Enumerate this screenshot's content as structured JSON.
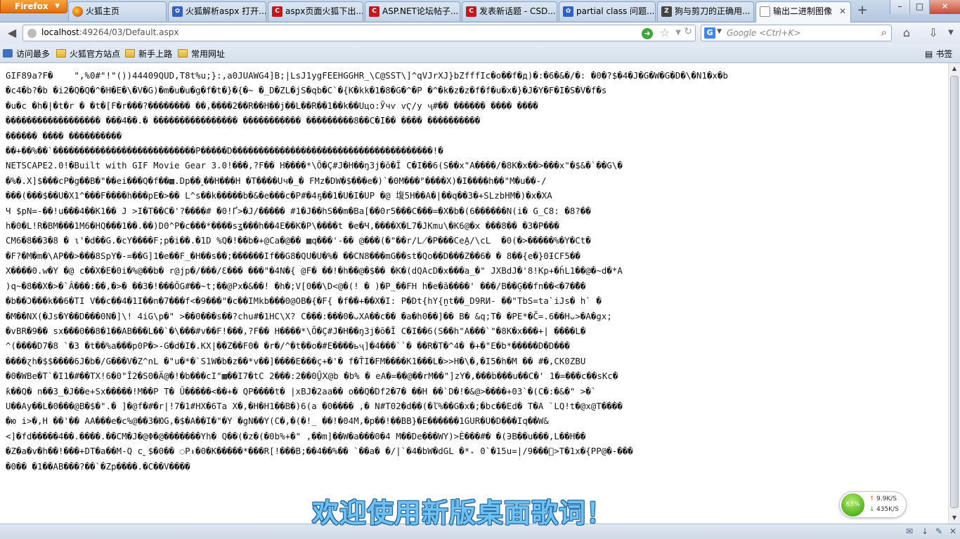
{
  "browser": {
    "menu_button": "Firefox",
    "tabs": [
      {
        "label": "火狐主页",
        "icon": "firefox-icon"
      },
      {
        "label": "火狐解析aspx 打开...",
        "icon": "paw-icon"
      },
      {
        "label": "aspx页面火狐下出...",
        "icon": "csdn-icon"
      },
      {
        "label": "ASP.NET论坛帖子...",
        "icon": "csdn-icon"
      },
      {
        "label": "发表新话题 - CSD...",
        "icon": "csdn-icon"
      },
      {
        "label": "partial class 问题...",
        "icon": "paw-icon"
      },
      {
        "label": "狗与剪刀的正确用...",
        "icon": "zhihu-icon"
      },
      {
        "label": "输出二进制图像",
        "icon": "page-icon",
        "active": true
      }
    ],
    "new_tab": "+",
    "window_controls": {
      "minimize": "–",
      "maximize": "□",
      "close": "✕"
    }
  },
  "navigation": {
    "url_host": "localhost",
    "url_rest": ":49264/03/Default.aspx",
    "search_engine": "G",
    "search_placeholder": "Google <Ctrl+K>"
  },
  "bookmarks": {
    "items": [
      {
        "label": "访问最多",
        "icon": "bookmark-icon"
      },
      {
        "label": "火狐官方站点",
        "icon": "folder-icon"
      },
      {
        "label": "新手上路",
        "icon": "folder-icon"
      },
      {
        "label": "常用网址",
        "icon": "folder-icon"
      }
    ],
    "right_label": "书签"
  },
  "page": {
    "lines": [
      "GIF89a?F�    \",%0#\"!\"())44409QUD,T8t%u;}:,a0JUAWG4]B;|LsJ1ygFEEHGGHR_\\C@SST\\]^qVJrXJ}bZfffIc�o��f�д)�:�6�&�/�: �0�?$�4�J�G�W�G�D�\\�N1�x�b",
      "�c4�b?�b �i2�Q�Q�^�H�E�\\�V�G)�m�u�u�g�f�t�}�{�~ �_D�ZL�jS�qb�C`�{K�kk�1�8�G�^�P �^�k�z�z�f�f�u�x�}�J�Y�F�I�S�V�f�s",
      "�u�c �h�|�t�r � �t�[F�r���?�������� ��,����2��R��H��j��L��R��1��k��Uцo:Ўчѵ ѵҀ/у ҷ#�� ������ ���� ����",
      "������������������ ���4��.� ���������������� ����������� ���������8��C�I�� ���� ����������",
      "������ ���� ����������",
      "��+��%��`���������������������������P�����D��������������������������������������!�",
      "NETSCAPE2.0!�Built with GIF Movie Gear 3.0!���,?F�� H����*\\Õ�Ç#J�H��ŋ3j�ō�Ĭ C�I��6(S��x\"A����/�8K�x��>���x\"�$&�`��G\\�",
      "�%�.X]$���cP�g��B�\"��ei���Q�f��▩.Dp��‸��H���H �T����Uч�_� FMz�DW�$���e�)`�0M���ᴾ����X)�I����h��\"M�u��-/",
      "���(���$��U�X1^���F����h���pE�>�� L^s��k�����b�&�e���c�P#�4ҕ��1�U�I�UP �@ 㙏5H��A�|��q��3�+SLzbHM�)�x�XA",
      "Ч $pN=-��!u���4��K1�� J >I�T��C�'?����# �0!Ґ>�J/����� #1�J��hS��m�Ba[��0r5���C���=�X�b�(6������N(i� G_C8: �8?��",
      "h�0�L!R�BM���1M6�HQ���1��.��)D0^P�c���*����sʓ���h��4E��K�P\\����t �e�Ч,����X�L7�JKmu\\�K6@�x ���8�� �3�P���",
      "CM6�8��3�8 � ι'�d��G.�cY����F;p�i��.�1D %Q�!��b�+@Ca�@�� ▩q���'-�� @���(�\"��r/L̸�P���CeA̱/\\cL  �0(�>�����%�Y�Ct�",
      "�F?�M�m�\\AP��>���8SpY�-=��G]1�e��F_�H��s��;������If��G8�QU�U�%� ��CN8���mG��st�Qo��D���Z��6� � 8��{e�}0ƗCF5��",
      "X����0.w�Y �@ c��X�E�0i�%@��b� r@jp�/���/Ɛ��� ���\"�4N�{ @F� ��!�h��@�$�� �K�(dQAcD�x���a_�\" JXBdJ�'8!Kp+�ȟL1��@�~d�*A",
      ")q~�8��X�>�`Â���:��,�>� ��3�!���ÕG#��~t;��@Px�&��! �h�;V[0��\\D<@�(! � )�P_��FH h�e�ã����' ���/B��Ģ��fn��<�7�̊��",
      "�b��Ͻ���k��6�TI V��c��4�1I��n�7���f<�9���\"�c��IMkb���0@OB�{�F{ �f��+��X�I: P�Dt{hY{̮nt��_D9RИ- ��\"TbS=ta`iJs� h` �",
      "�M��NX(�Js�Y��D���0N�]\\! 4iG\\p�\" >��0���s��?chu#�1HC\\X? C���:���0�ᴗXA��c�� �a�h0��]�� B� &q;T� �PE*�C̆=.6��Hᴗ>�A�gx;",
      "�vBR�9�� sx���0��8�1��AB���L��`�\\���#v��F!���,?F�� H����*\\Õ�Ç#J�H��ŋ3j�ō�Ĭ C�I��6(S��h\"A���`\"�8K�x���+| ����L�",
      "^(����D7�8 `�З �t��%a���p0P�>-G�d�I�.KX|��Z��F0� �r�/^�t��o�#E����ьҷ]�4���``� ��R�T�^4� �+�\"E�b*�����D�D���",
      "����ɀh�$$����6J�b�/G���V�Z^nL �\"u�*�`S1W�b�z��*v��]����E���ҫ+�'� f�ŤI�FM����K1���L�>>H�\\�,�I5�h�M �� #�,CK0ZBU",
      "�0�WBe�T`�I1�#��TX!6�0\"Ȋ2�S0�Ä@�!�b���cI\"▩��I7�tC 2���:2��0Ű̱Ⅹ@b �b% � eA�=��@��rM��\"]zY�,���b���u��C�' 1�=���c��sKc�",
      "ƙ��Q� n��3_�J��e+Sx�����!M��P T� Ũ�����<��+� QP����t� |xBJ�2aa�� o��Q�Df2�7� ��H ��`D�!�&@>����+03`�(C�:�&�\" >�`",
      "U��Ay��L�0���@B�$�\".� ]�@f�#�r|!7�1#HX�6Ta X�,�H�H1��B�)6(a �0���� ,� N#T02�d��(�ľ%��G�x�;�bc��Ed� T�A `LQ!t�@x@T����",
      "�ю i>�,H ��'�� AA���e�c%@��3�ЮG,�$�A��I�\"�Y �gN��Y(C�,�(�!_ ��!�04M,�p��!��BB}�E������1GUR�U�D���Iq��W&",
      "<]�fd�����4��.����.��CM�J�@Φ�@�������Yh� Q��(�z�(�0b%+�\" ,��m]��W�a���0�4 M��De���WY)>È���#� �(ЭB��u���,L��H��",
      "�Z�a�v�h��!���+DT�a��M-Q c˷$�0�� ◌Pᵼ�0�K�����*���R[!���B;��4��%�� `��a� �/|`�4�bW�dGL �*₊ 0`�15u=|/9���ᷫ>T�1x�{PP@�-���",
      "�0�� �1��AB���?��`�Zp����.�C��V����"
    ]
  },
  "overlays": {
    "lyric_text": "欢迎使用新版桌面歌词！",
    "net_monitor": {
      "percent": "63%",
      "upload": "9.9K/S",
      "download": "435K/S",
      "upload_arrow": "↑",
      "download_arrow": "↓"
    }
  }
}
